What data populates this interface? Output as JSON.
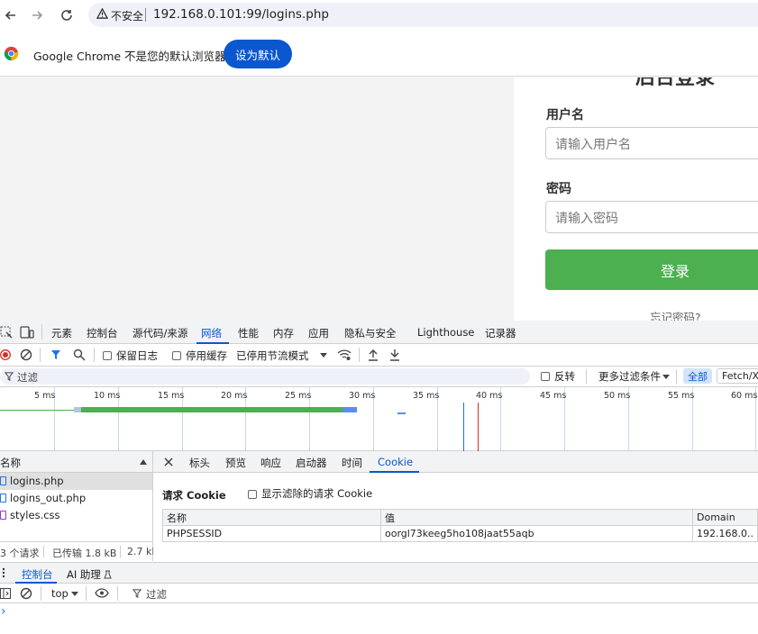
{
  "browser": {
    "insecure_label": "不安全",
    "url": "192.168.0.101:99/logins.php"
  },
  "infobar": {
    "message": "Google Chrome 不是您的默认浏览器",
    "set_default_label": "设为默认"
  },
  "page": {
    "title": "后台登录",
    "username_label": "用户名",
    "username_placeholder": "请输入用户名",
    "password_label": "密码",
    "password_placeholder": "请输入密码",
    "login_label": "登录",
    "forgot_label": "忘记密码?",
    "login_color": "#4caf50"
  },
  "devtools": {
    "tabs": [
      "元素",
      "控制台",
      "源代码/来源",
      "网络",
      "性能",
      "内存",
      "应用",
      "隐私与安全",
      "Lighthouse",
      "记录器"
    ],
    "active_tab": "网络",
    "controls": {
      "preserve_log": "保留日志",
      "disable_cache": "停用缓存",
      "throttle": "已停用节流模式"
    },
    "filter": {
      "placeholder": "过滤",
      "invert": "反转",
      "more_filters": "更多过滤条件",
      "all": "全部",
      "fetch": "Fetch/XHR"
    },
    "timeline_ticks": [
      "5 ms",
      "10 ms",
      "15 ms",
      "20 ms",
      "25 ms",
      "30 ms",
      "35 ms",
      "40 ms",
      "45 ms",
      "50 ms",
      "55 ms",
      "60 ms"
    ],
    "list_header": "名称",
    "requests": [
      "logins.php",
      "logins_out.php",
      "styles.css"
    ],
    "summary": {
      "requests": "3 个请求",
      "transferred": "已传输 1.8 kB",
      "resources": "2.7 kB"
    },
    "detail_tabs": [
      "标头",
      "预览",
      "响应",
      "启动器",
      "时间",
      "Cookie"
    ],
    "active_detail_tab": "Cookie",
    "cookie_section": {
      "title": "请求 Cookie",
      "show_filtered": "显示滤除的请求 Cookie",
      "columns": [
        "名称",
        "值",
        "Domain"
      ],
      "rows": [
        [
          "PHPSESSID",
          "oorgl73keeg5ho108jaat55aqb",
          "192.168.0.."
        ]
      ]
    },
    "drawer_tabs": [
      "控制台",
      "AI 助理"
    ],
    "console": {
      "context": "top",
      "filter_placeholder": "过滤",
      "prompt": "›"
    }
  }
}
